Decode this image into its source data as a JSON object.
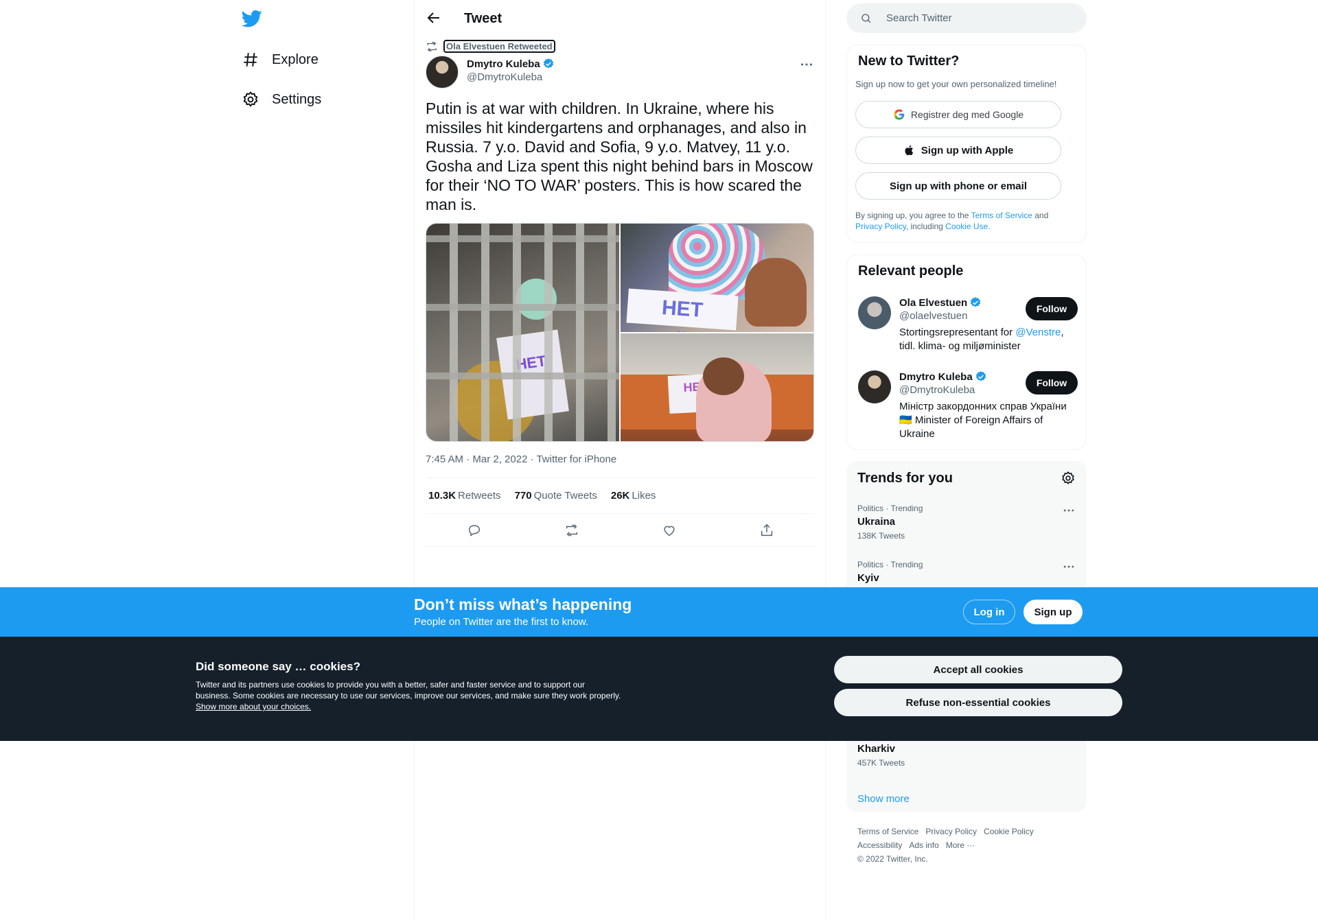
{
  "nav": {
    "items": [
      {
        "label": "Explore",
        "icon": "hashtag-icon"
      },
      {
        "label": "Settings",
        "icon": "gear-icon"
      }
    ]
  },
  "header": {
    "title": "Tweet"
  },
  "tweet": {
    "retweeted_by": "Ola Elvestuen Retweeted",
    "author_name": "Dmytro Kuleba",
    "author_handle": "@DmytroKuleba",
    "text": "Putin is at war with children. In Ukraine, where his missiles hit kindergartens and orphanages, and also in Russia. 7 y.o. David and Sofia, 9 y.o. Matvey, 11 y.o. Gosha and Liza spent this night behind bars in Moscow for their ‘NO TO WAR’ posters. This is how scared the man is.",
    "photo_sign_1": "НЕТ ВОЙНЕ",
    "photo_sign_2": "НЕТ",
    "timestamp": "7:45 AM · Mar 2, 2022 · Twitter for iPhone",
    "stats": {
      "retweets_count": "10.3K",
      "retweets_label": "Retweets",
      "quotes_count": "770",
      "quotes_label": "Quote Tweets",
      "likes_count": "26K",
      "likes_label": "Likes"
    }
  },
  "search": {
    "placeholder": "Search Twitter"
  },
  "new_to_twitter": {
    "title": "New to Twitter?",
    "subtitle": "Sign up now to get your own personalized timeline!",
    "google_label": "Registrer deg med Google",
    "apple_label": "Sign up with Apple",
    "phone_label": "Sign up with phone or email",
    "legal_1": "By signing up, you agree to the ",
    "terms": "Terms of Service",
    "legal_2": " and ",
    "privacy": "Privacy Policy",
    "legal_3": ", including ",
    "cookie_use": "Cookie Use."
  },
  "relevant_people": {
    "title": "Relevant people",
    "people": [
      {
        "name": "Ola Elvestuen",
        "handle": "@olaelvestuen",
        "bio_1": "Stortingsrepresentant for ",
        "bio_link": "@Venstre",
        "bio_2": ", tidl. klima- og miljøminister",
        "follow": "Follow"
      },
      {
        "name": "Dmytro Kuleba",
        "handle": "@DmytroKuleba",
        "bio": "Міністр закордонних справ України 🇺🇦 Minister of Foreign Affairs of Ukraine",
        "follow": "Follow"
      }
    ]
  },
  "trends": {
    "title": "Trends for you",
    "items": [
      {
        "meta": "Politics · Trending",
        "name": "Ukraina",
        "count": "138K Tweets"
      },
      {
        "meta": "Politics · Trending",
        "name": "Kyiv",
        "count": ""
      },
      {
        "meta": "",
        "name": "Kharkiv",
        "count": "457K Tweets"
      }
    ],
    "show_more": "Show more"
  },
  "footer": {
    "links": [
      "Terms of Service",
      "Privacy Policy",
      "Cookie Policy",
      "Accessibility",
      "Ads info",
      "More ···"
    ],
    "copyright": "© 2022 Twitter, Inc."
  },
  "banner": {
    "title": "Don’t miss what’s happening",
    "subtitle": "People on Twitter are the first to know.",
    "login": "Log in",
    "signup": "Sign up"
  },
  "cookies": {
    "title": "Did someone say … cookies?",
    "text": "Twitter and its partners use cookies to provide you with a better, safer and faster service and to support our business. Some cookies are necessary to use our services, improve our services, and make sure they work properly. ",
    "link": "Show more about your choices.",
    "accept": "Accept all cookies",
    "refuse": "Refuse non-essential cookies"
  },
  "colors": {
    "brand": "#1d9bf0",
    "dark": "#0f1419",
    "muted": "#536471",
    "cookie_bg": "#15202b"
  }
}
